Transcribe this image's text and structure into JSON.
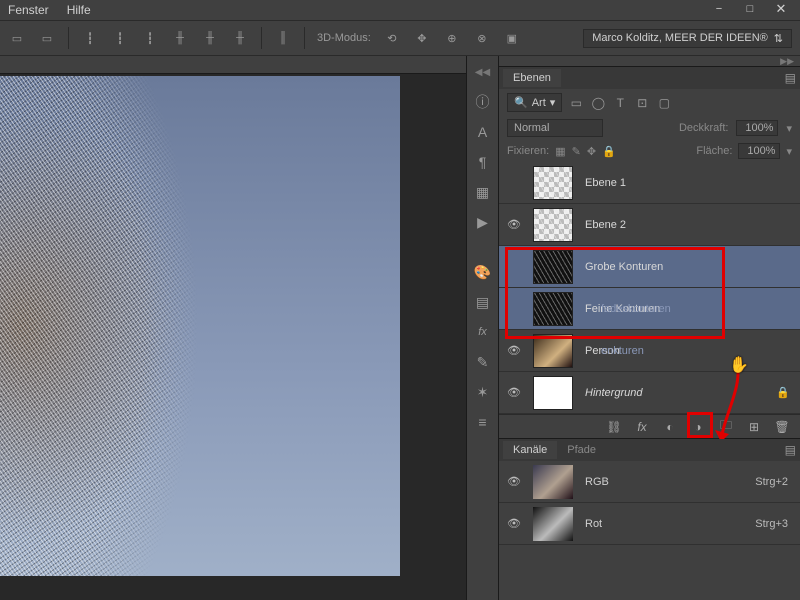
{
  "menu": {
    "items": [
      "Fenster",
      "Hilfe"
    ]
  },
  "window_controls": {
    "minimize": "−",
    "maximize": "□",
    "close": "✕"
  },
  "options_bar": {
    "mode_label": "3D-Modus:",
    "workspace": "Marco Kolditz, MEER DER IDEEN®"
  },
  "layers_panel": {
    "tab": "Ebenen",
    "filter_label": "Art",
    "blend_mode": "Normal",
    "opacity_label": "Deckkraft:",
    "opacity_value": "100%",
    "lock_label": "Fixieren:",
    "fill_label": "Fläche:",
    "fill_value": "100%",
    "layers": [
      {
        "name": "Ebene 1",
        "visible": false,
        "thumb": "checker"
      },
      {
        "name": "Ebene 2",
        "visible": true,
        "thumb": "checker"
      },
      {
        "name": "Grobe Konturen",
        "visible": false,
        "thumb": "dark",
        "selected": true,
        "ghost": ""
      },
      {
        "name": "Feine Konturen",
        "visible": false,
        "thumb": "dark",
        "selected": true,
        "ghost": "fadeskonturen"
      },
      {
        "name": "Person",
        "visible": true,
        "thumb": "person",
        "ghost": "enkturen"
      },
      {
        "name": "Hintergrund",
        "visible": true,
        "thumb": "white",
        "locked": true,
        "italic": true
      }
    ]
  },
  "channels_panel": {
    "tabs": [
      "Kanäle",
      "Pfade"
    ],
    "channels": [
      {
        "name": "RGB",
        "shortcut": "Strg+2",
        "visible": true,
        "thumb": "rgb"
      },
      {
        "name": "Rot",
        "shortcut": "Strg+3",
        "visible": true,
        "thumb": "bw"
      }
    ]
  },
  "icons": {
    "info": "ⓘ",
    "text": "A",
    "paragraph": "¶",
    "swatch": "▦",
    "play": "▶",
    "palette": "🎨",
    "grid": "▤",
    "fx": "fx",
    "brush": "✎",
    "mixer": "✶",
    "timeline": "≡",
    "search": "🔍",
    "image": "▭",
    "circle": "◯",
    "type": "T",
    "crop": "⊡",
    "lock": "🔒",
    "link": "⛓",
    "mask": "◐",
    "adjust": "◑",
    "folder": "🗀",
    "new": "⊞",
    "trash": "🗑",
    "eye": "👁"
  }
}
